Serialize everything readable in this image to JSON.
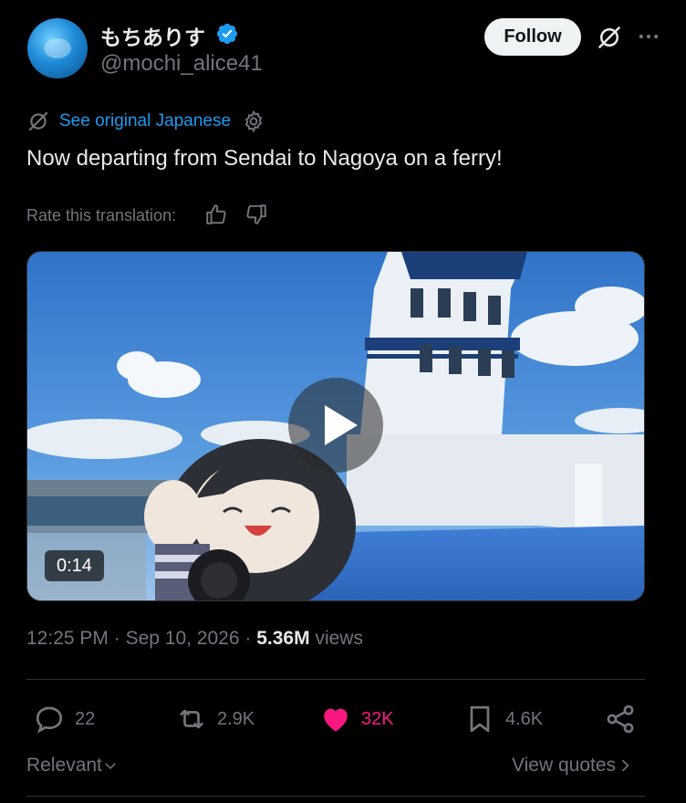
{
  "author": {
    "display_name": "もちありす",
    "handle": "@mochi_alice41",
    "verified": true,
    "follow_label": "Follow"
  },
  "translation": {
    "see_original_label": "See original Japanese",
    "translated_text": "Now departing from Sendai to Nagoya on a ferry!",
    "rate_label": "Rate this translation:"
  },
  "media": {
    "duration": "0:14"
  },
  "meta": {
    "time": "12:25 PM",
    "sep1": "·",
    "date": "Sep 10, 2026",
    "sep2": "·",
    "views_count": "5.36M",
    "views_label": "views"
  },
  "actions": {
    "replies": "22",
    "reposts": "2.9K",
    "likes": "32K",
    "bookmarks": "4.6K"
  },
  "footer": {
    "sort_label": "Relevant",
    "view_quotes_label": "View quotes"
  },
  "colors": {
    "accent": "#1d9bf0",
    "like": "#f91880",
    "muted": "#71767b"
  }
}
